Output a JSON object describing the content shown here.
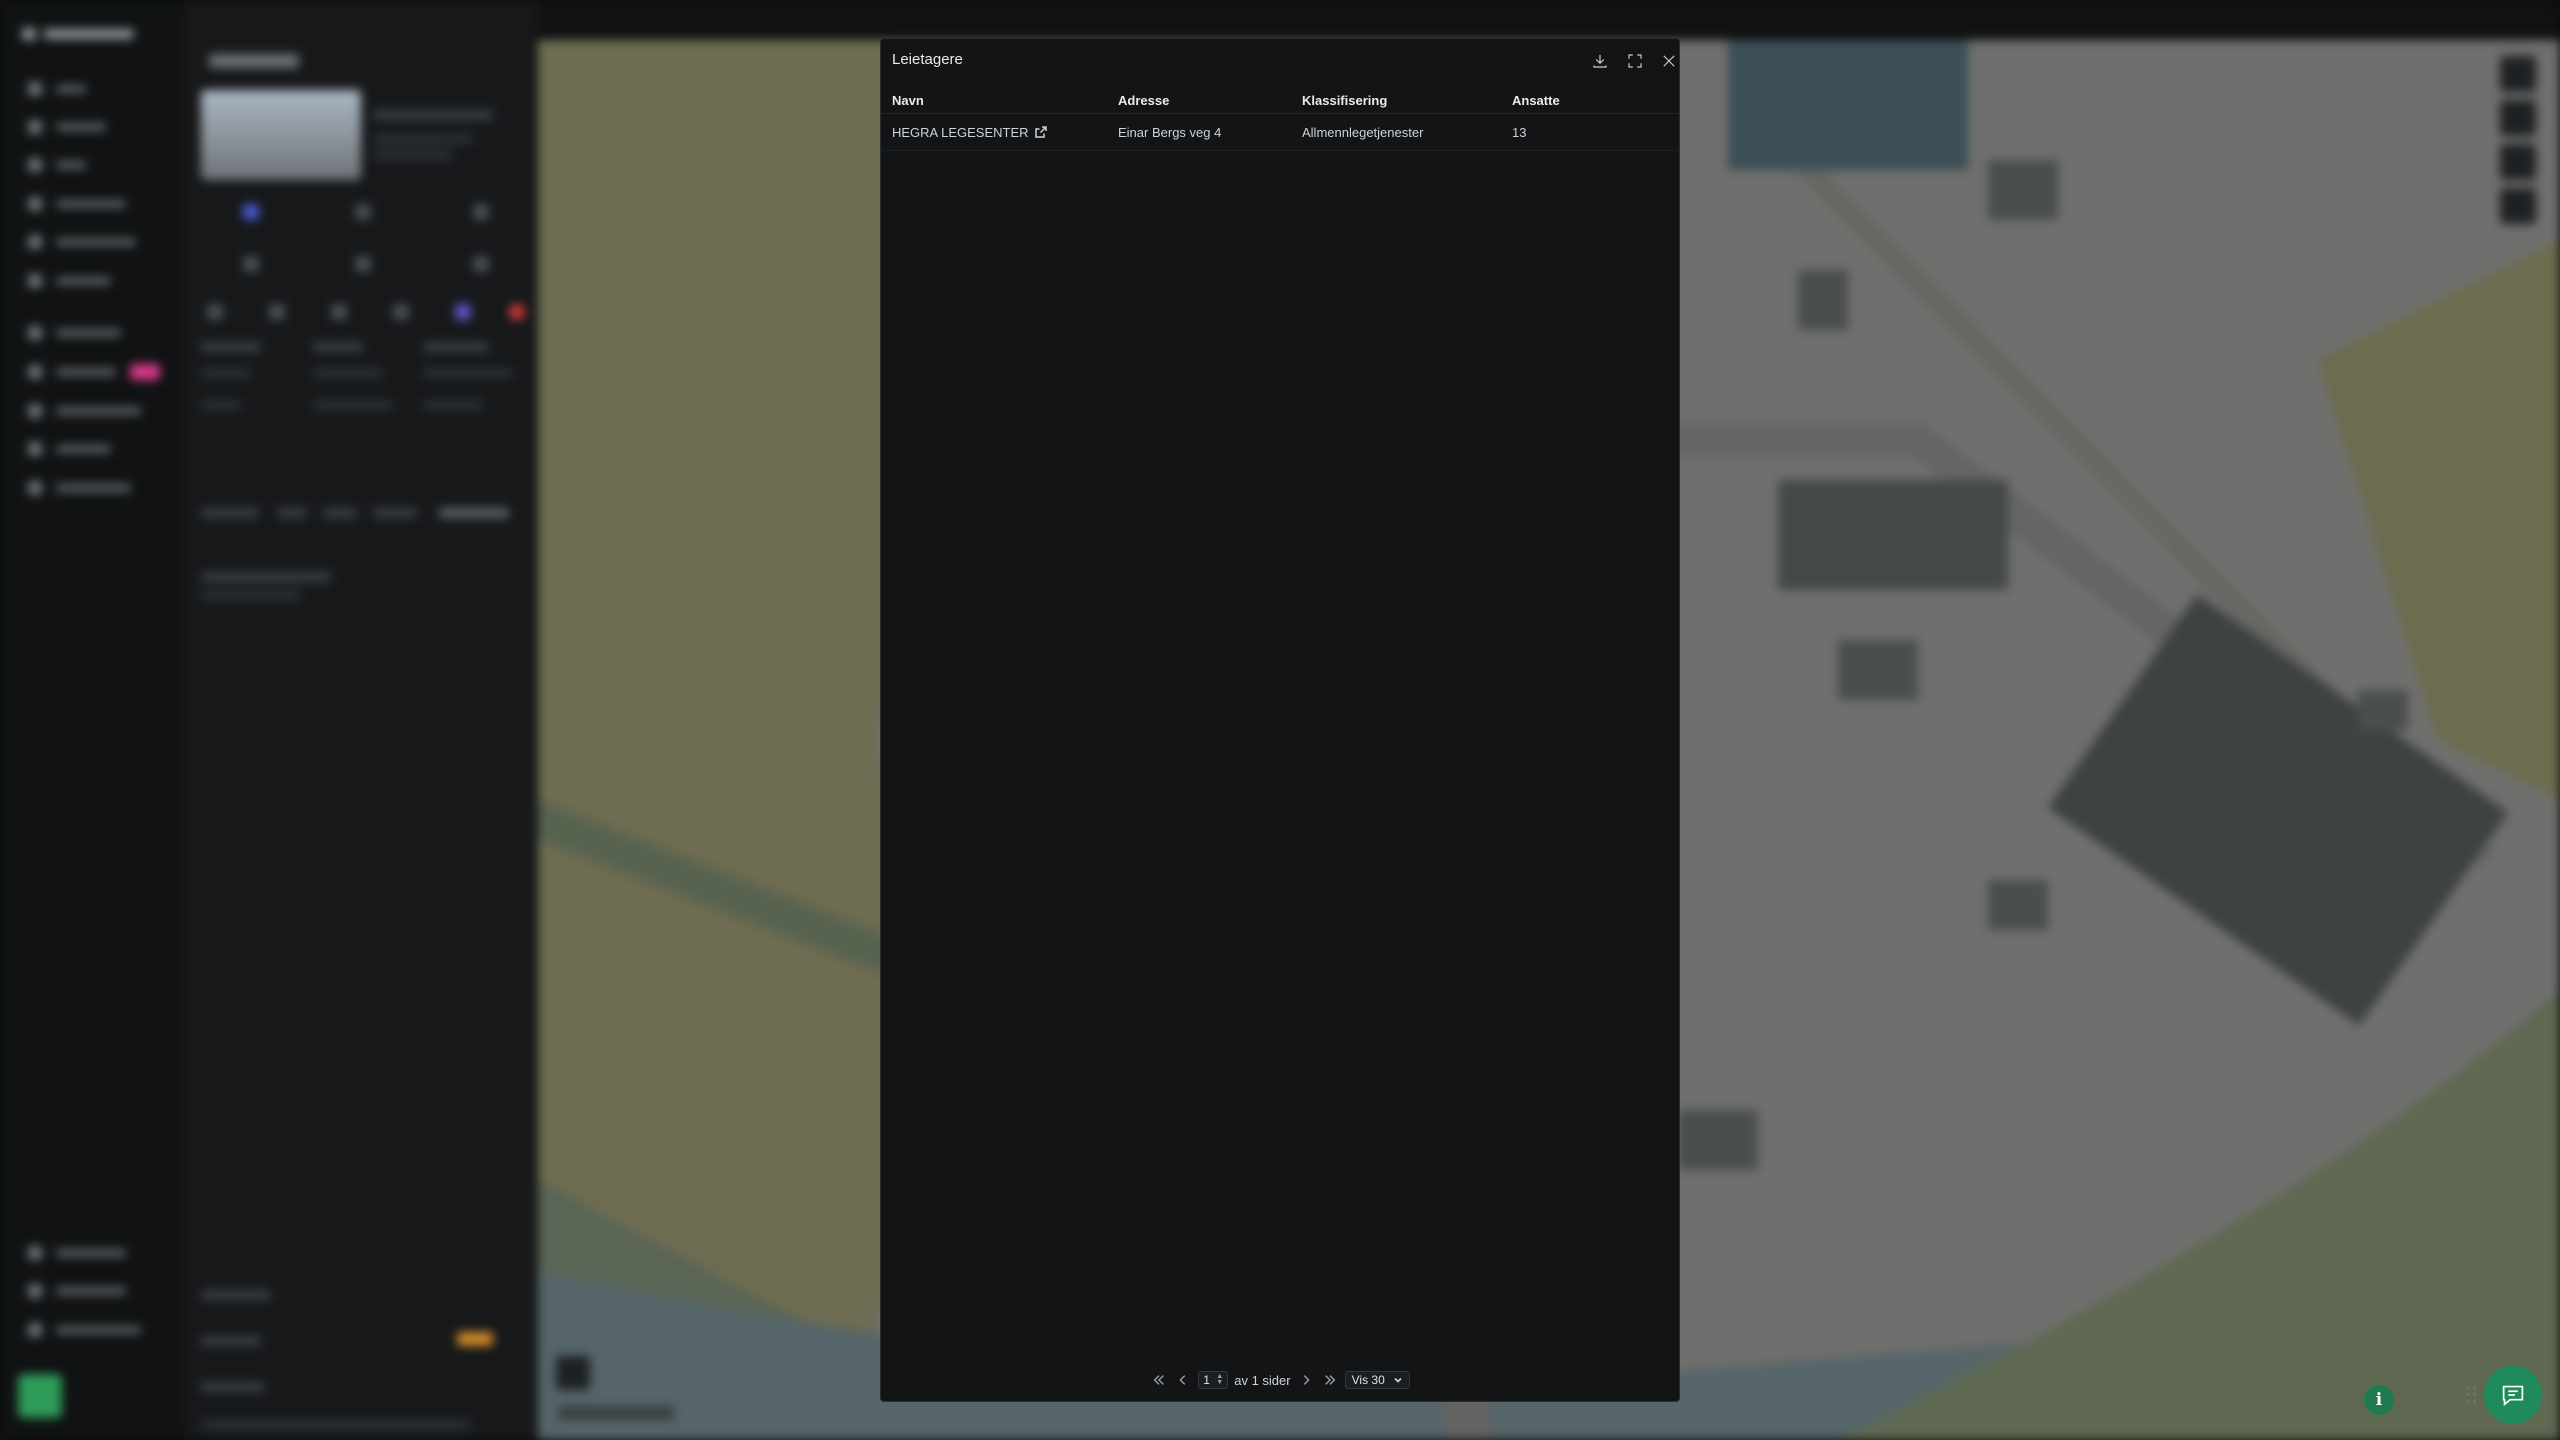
{
  "modal": {
    "title": "Leietagere",
    "columns": [
      "Navn",
      "Adresse",
      "Klassifisering",
      "Ansatte"
    ],
    "rows": [
      {
        "name": "HEGRA LEGESENTER",
        "address": "Einar Bergs veg 4",
        "classification": "Allmennlegetjenester",
        "employees": "13"
      }
    ],
    "pagination": {
      "current_page": "1",
      "of_label": "av 1 sider",
      "per_page": "Vis 30"
    }
  },
  "colors": {
    "accent": "#1f8a5c",
    "nav_badge": "#d63a8a"
  }
}
